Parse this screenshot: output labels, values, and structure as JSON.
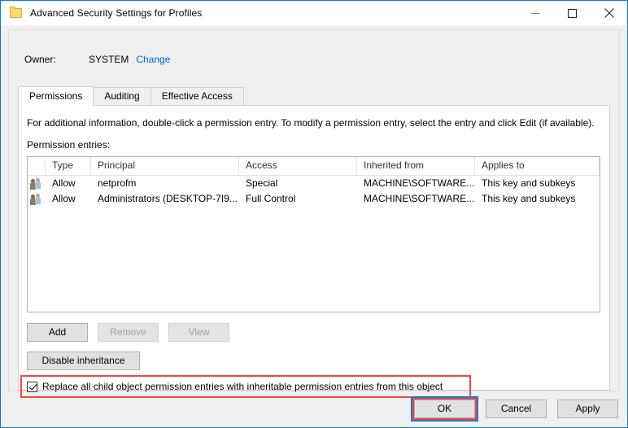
{
  "window": {
    "title": "Advanced Security Settings for Profiles",
    "icon": "folder-icon",
    "controls": {
      "minimize": "minimize-button",
      "maximize": "maximize-button",
      "close": "close-button"
    },
    "accent_color": "#0a79d6",
    "highlight_color": "#f2473f",
    "link_color": "#0066cc"
  },
  "owner": {
    "label": "Owner:",
    "value": "SYSTEM",
    "change_link": "Change"
  },
  "tabs": [
    {
      "label": "Permissions",
      "active": true
    },
    {
      "label": "Auditing",
      "active": false
    },
    {
      "label": "Effective Access",
      "active": false
    }
  ],
  "main": {
    "hint": "For additional information, double-click a permission entry. To modify a permission entry, select the entry and click Edit (if available).",
    "entries_label": "Permission entries:",
    "columns": [
      "Type",
      "Principal",
      "Access",
      "Inherited from",
      "Applies to"
    ],
    "rows": [
      {
        "icon": "users-group-icon",
        "type": "Allow",
        "principal": "netprofm",
        "access": "Special",
        "inherited_from": "MACHINE\\SOFTWARE...",
        "applies_to": "This key and subkeys"
      },
      {
        "icon": "users-group-icon",
        "type": "Allow",
        "principal": "Administrators (DESKTOP-7I9...",
        "access": "Full Control",
        "inherited_from": "MACHINE\\SOFTWARE...",
        "applies_to": "This key and subkeys"
      }
    ],
    "entry_buttons": [
      {
        "label": "Add",
        "enabled": true
      },
      {
        "label": "Remove",
        "enabled": false
      },
      {
        "label": "View",
        "enabled": false
      }
    ],
    "inheritance_button": {
      "label": "Disable inheritance",
      "enabled": true
    },
    "replace_checkbox": {
      "label": "Replace all child object permission entries with inheritable permission entries from this object",
      "checked": true,
      "highlighted": true
    }
  },
  "footer": {
    "ok": "OK",
    "cancel": "Cancel",
    "apply": "Apply",
    "ok_focused": true,
    "ok_highlighted": true
  }
}
